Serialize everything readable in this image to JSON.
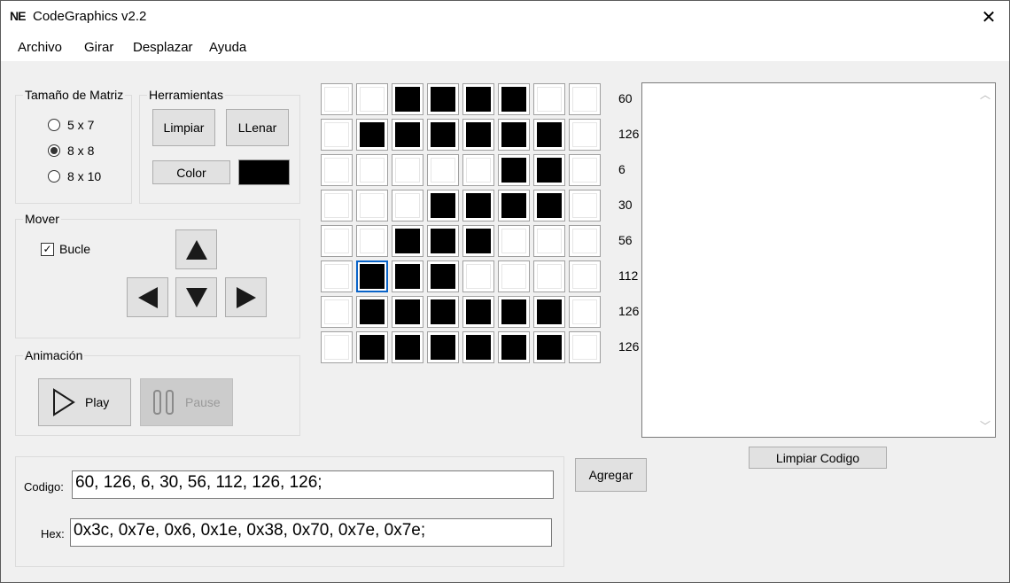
{
  "window": {
    "logo": "NE",
    "title": "CodeGraphics v2.2",
    "close_glyph": "✕"
  },
  "menu": [
    "Archivo",
    "Girar",
    "Desplazar",
    "Ayuda"
  ],
  "matrix_size": {
    "label": "Tamaño de Matriz",
    "options": [
      "5 x 7",
      "8 x 8",
      "8 x 10"
    ],
    "selected": "8 x 8"
  },
  "tools": {
    "label": "Herramientas",
    "clear": "Limpiar",
    "fill": "LLenar",
    "color": "Color",
    "color_value": "#000000"
  },
  "move": {
    "label": "Mover",
    "loop_label": "Bucle",
    "loop_checked": true
  },
  "animation": {
    "label": "Animación",
    "play": "Play",
    "pause": "Pause"
  },
  "grid": {
    "rows": [
      [
        0,
        0,
        1,
        1,
        1,
        1,
        0,
        0
      ],
      [
        0,
        1,
        1,
        1,
        1,
        1,
        1,
        0
      ],
      [
        0,
        0,
        0,
        0,
        0,
        1,
        1,
        0
      ],
      [
        0,
        0,
        0,
        1,
        1,
        1,
        1,
        0
      ],
      [
        0,
        0,
        1,
        1,
        1,
        0,
        0,
        0
      ],
      [
        0,
        1,
        1,
        1,
        0,
        0,
        0,
        0
      ],
      [
        0,
        1,
        1,
        1,
        1,
        1,
        1,
        0
      ],
      [
        0,
        1,
        1,
        1,
        1,
        1,
        1,
        0
      ]
    ],
    "selected_cell": [
      5,
      1
    ],
    "row_values": [
      "60",
      "126",
      "6",
      "30",
      "56",
      "112",
      "126",
      "126"
    ]
  },
  "code_output": {
    "text": "",
    "clear_button": "Limpiar Codigo"
  },
  "code": {
    "codigo_label": "Codigo:",
    "codigo_value": "60, 126, 6, 30, 56, 112, 126, 126;",
    "hex_label": "Hex:",
    "hex_value": "0x3c, 0x7e, 0x6, 0x1e, 0x38, 0x70, 0x7e, 0x7e;",
    "add_button": "Agregar"
  }
}
